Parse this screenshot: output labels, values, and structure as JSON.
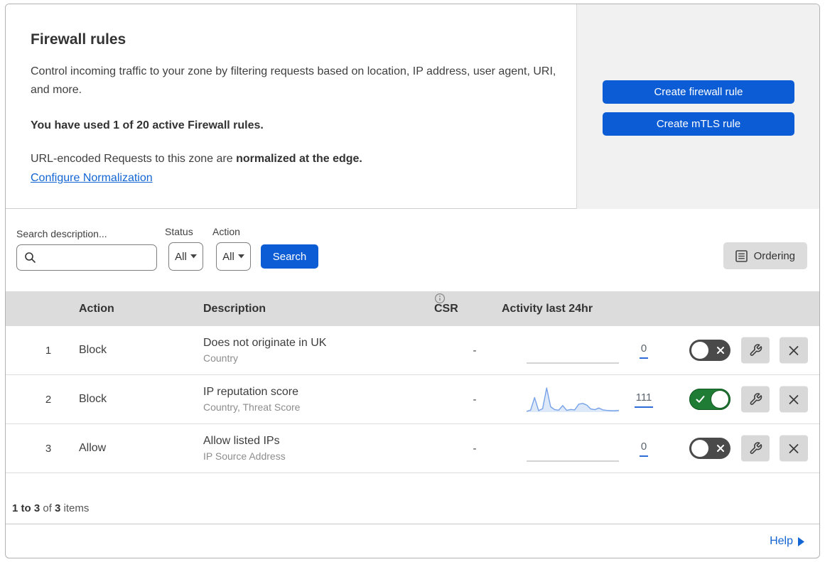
{
  "header": {
    "title": "Firewall rules",
    "description": "Control incoming traffic to your zone by filtering requests based on location, IP address, user agent, URI, and more.",
    "usage_line": "You have used 1 of 20 active Firewall rules.",
    "normalization_text": "URL-encoded Requests to this zone are ",
    "normalization_bold": "normalized at the edge.",
    "configure_link": "Configure Normalization"
  },
  "actions_panel": {
    "create_firewall_rule": "Create firewall rule",
    "create_mtls_rule": "Create mTLS rule"
  },
  "filters": {
    "search_label": "Search description...",
    "status_label": "Status",
    "status_value": "All",
    "action_label": "Action",
    "action_value": "All",
    "search_button": "Search",
    "ordering_button": "Ordering"
  },
  "table": {
    "columns": {
      "action": "Action",
      "description": "Description",
      "csr": "CSR",
      "activity": "Activity last 24hr"
    },
    "rows": [
      {
        "priority": "1",
        "action": "Block",
        "description": "Does not originate in UK",
        "fields": "Country",
        "csr": "-",
        "activity_count": "0",
        "enabled": false,
        "sparkline": [
          0,
          0,
          0,
          0,
          0,
          0,
          0,
          0,
          0,
          0,
          0,
          0,
          0,
          0,
          0,
          0,
          0,
          0,
          0,
          0,
          0,
          0,
          0,
          0
        ]
      },
      {
        "priority": "2",
        "action": "Block",
        "description": "IP reputation score",
        "fields": "Country, Threat Score",
        "csr": "-",
        "activity_count": "111",
        "enabled": true,
        "sparkline": [
          3,
          8,
          60,
          6,
          14,
          100,
          22,
          10,
          8,
          27,
          7,
          11,
          9,
          33,
          36,
          29,
          13,
          10,
          17,
          9,
          7,
          6,
          6,
          7
        ]
      },
      {
        "priority": "3",
        "action": "Allow",
        "description": "Allow listed IPs",
        "fields": "IP Source Address",
        "csr": "-",
        "activity_count": "0",
        "enabled": false,
        "sparkline": [
          0,
          0,
          0,
          0,
          0,
          0,
          0,
          0,
          0,
          0,
          0,
          0,
          0,
          0,
          0,
          0,
          0,
          0,
          0,
          0,
          0,
          0,
          0,
          0
        ]
      }
    ]
  },
  "footer": {
    "range_bold": "1 to 3",
    "of_text": " of ",
    "total_bold": "3",
    "items_text": " items",
    "help_label": "Help"
  },
  "icons": {
    "search": "magnifier",
    "dropdown_caret": "▼",
    "ordering": "ordered-list",
    "info": "ⓘ",
    "toggle_off": "✕",
    "toggle_on": "✓",
    "edit_rule": "wrench",
    "delete_rule": "✕",
    "help_arrow": "▶"
  },
  "colors": {
    "primary_button": "#0b5cd5",
    "link_blue": "#1265d3",
    "toggle_on_green": "#1e7c34",
    "toggle_off_gray": "#4a4a4a",
    "sparkline_line": "#76a2e8",
    "sparkline_fill": "#dde8f8",
    "table_header_bg": "#dcdcdc",
    "panel_bg": "#f1f1f1"
  }
}
